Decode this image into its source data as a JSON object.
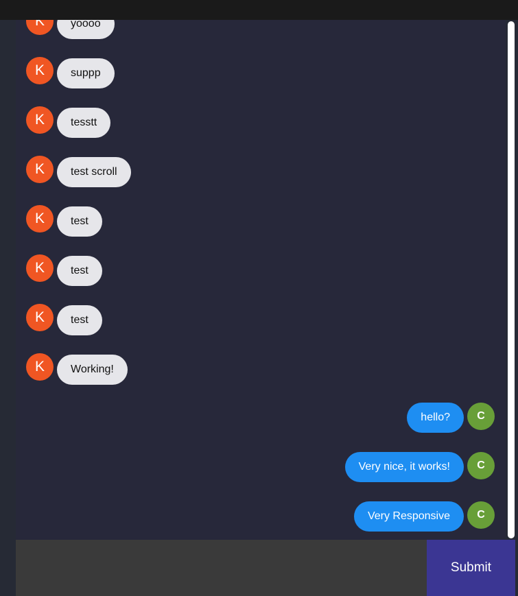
{
  "messages": [
    {
      "sender": "other",
      "initial": "K",
      "text": "yoooo"
    },
    {
      "sender": "other",
      "initial": "K",
      "text": "suppp"
    },
    {
      "sender": "other",
      "initial": "K",
      "text": "tesstt"
    },
    {
      "sender": "other",
      "initial": "K",
      "text": "test scroll"
    },
    {
      "sender": "other",
      "initial": "K",
      "text": "test"
    },
    {
      "sender": "other",
      "initial": "K",
      "text": "test"
    },
    {
      "sender": "other",
      "initial": "K",
      "text": "test"
    },
    {
      "sender": "other",
      "initial": "K",
      "text": "Working!"
    },
    {
      "sender": "self",
      "initial": "C",
      "text": "hello?"
    },
    {
      "sender": "self",
      "initial": "C",
      "text": "Very nice, it works!"
    },
    {
      "sender": "self",
      "initial": "C",
      "text": "Very Responsive"
    }
  ],
  "composer": {
    "value": "",
    "placeholder": ""
  },
  "submit_label": "Submit",
  "colors": {
    "avatar_other": "#f05623",
    "avatar_self": "#689f38",
    "bubble_other": "#e6e6ea",
    "bubble_self": "#1e8ef2",
    "submit": "#3b3693"
  }
}
